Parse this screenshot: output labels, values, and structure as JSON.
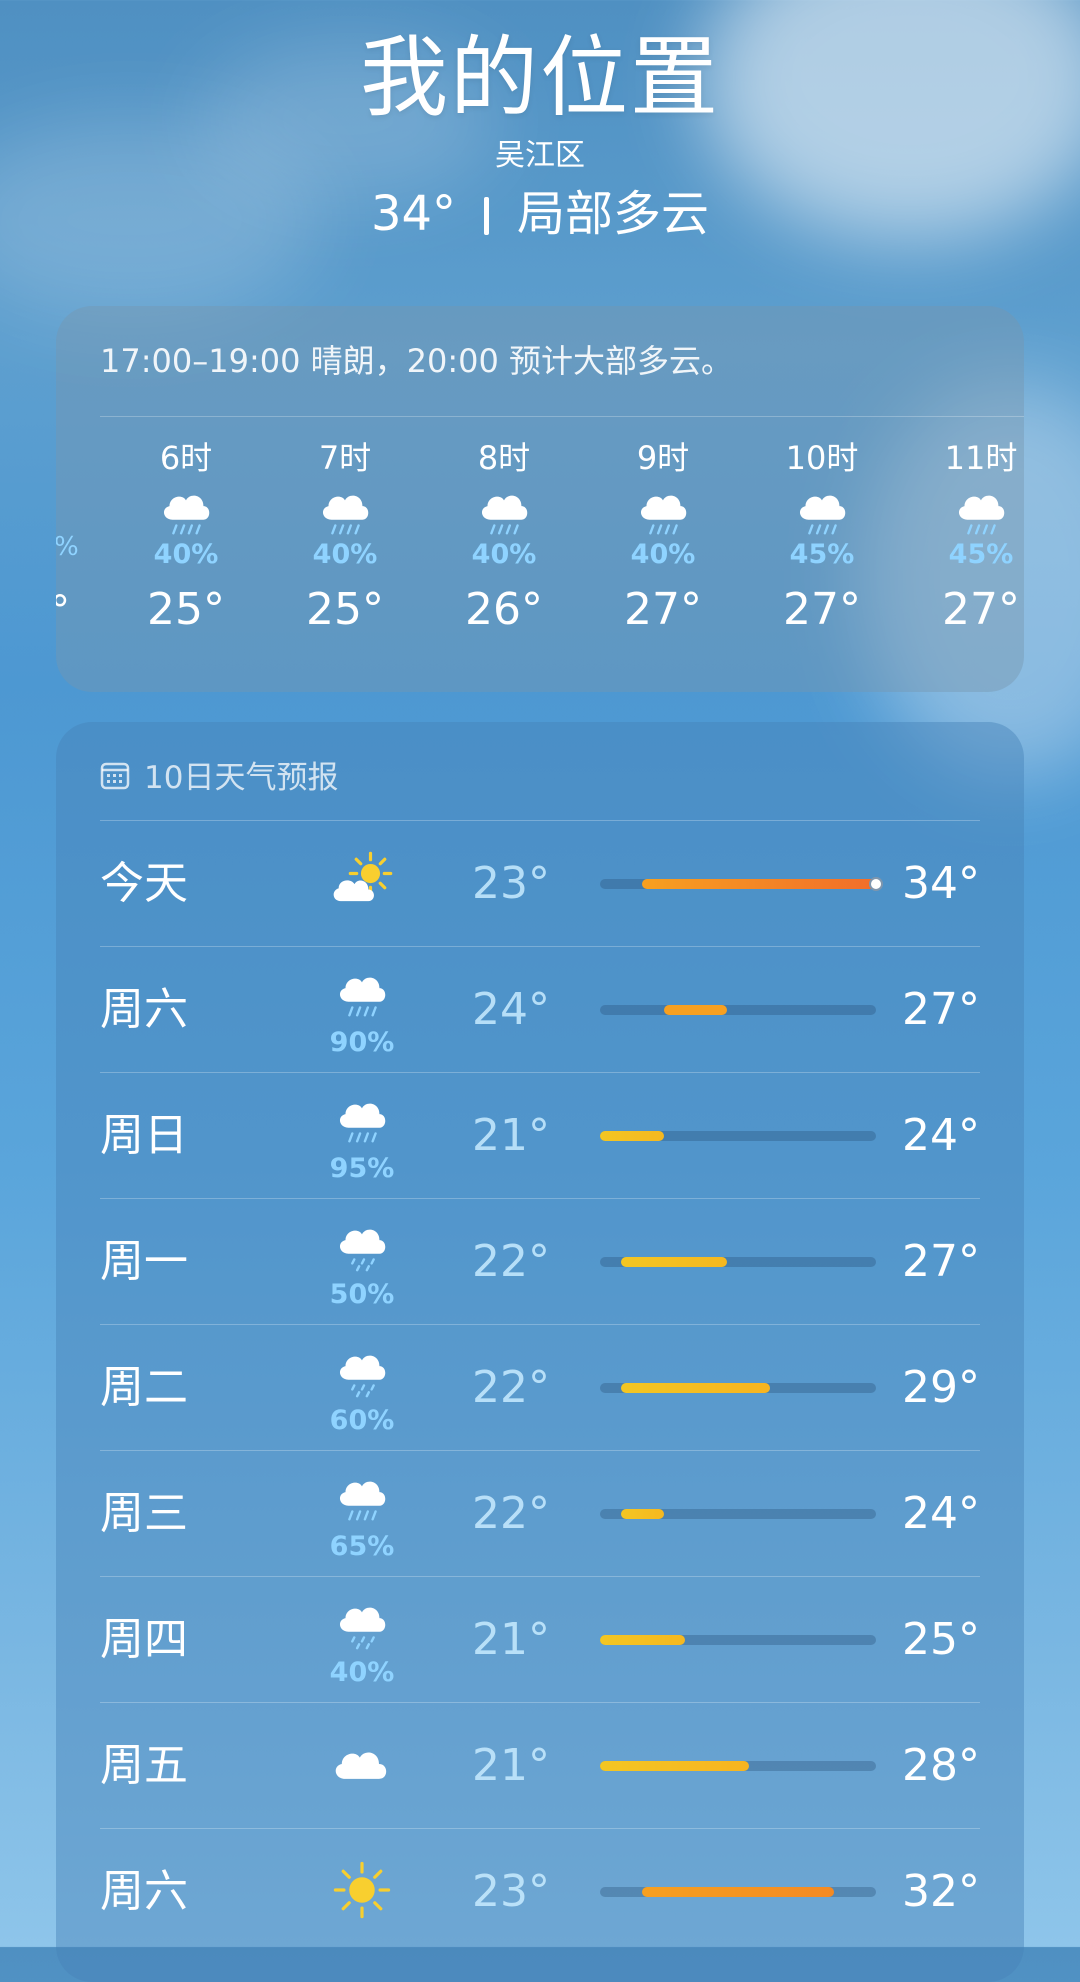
{
  "header": {
    "title": "我的位置",
    "district": "吴江区",
    "temp": "34°",
    "condition": "局部多云"
  },
  "hourly": {
    "summary": "17:00–19:00 晴朗，20:00 预计大部多云。",
    "edge_fragment_pct": "%",
    "edge_fragment_temp": "°",
    "hours": [
      {
        "label": "6时",
        "icon": "rain-cloud-icon",
        "pct": "40%",
        "temp": "25°"
      },
      {
        "label": "7时",
        "icon": "rain-cloud-icon",
        "pct": "40%",
        "temp": "25°"
      },
      {
        "label": "8时",
        "icon": "rain-cloud-icon",
        "pct": "40%",
        "temp": "26°"
      },
      {
        "label": "9时",
        "icon": "rain-cloud-icon",
        "pct": "40%",
        "temp": "27°"
      },
      {
        "label": "10时",
        "icon": "rain-cloud-icon",
        "pct": "45%",
        "temp": "27°"
      },
      {
        "label": "11时",
        "icon": "rain-cloud-icon",
        "pct": "45%",
        "temp": "27°"
      }
    ]
  },
  "daily": {
    "header": "10日天气预报",
    "range_min": 21,
    "range_max": 34,
    "current_temp": 34,
    "days": [
      {
        "day": "今天",
        "icon": "partly-sunny-icon",
        "pct": "",
        "low": "23°",
        "high": "34°",
        "low_v": 23,
        "high_v": 34
      },
      {
        "day": "周六",
        "icon": "rain-cloud-icon",
        "pct": "90%",
        "low": "24°",
        "high": "27°",
        "low_v": 24,
        "high_v": 27
      },
      {
        "day": "周日",
        "icon": "rain-cloud-icon",
        "pct": "95%",
        "low": "21°",
        "high": "24°",
        "low_v": 21,
        "high_v": 24
      },
      {
        "day": "周一",
        "icon": "drizzle-cloud-icon",
        "pct": "50%",
        "low": "22°",
        "high": "27°",
        "low_v": 22,
        "high_v": 27
      },
      {
        "day": "周二",
        "icon": "drizzle-cloud-icon",
        "pct": "60%",
        "low": "22°",
        "high": "29°",
        "low_v": 22,
        "high_v": 29
      },
      {
        "day": "周三",
        "icon": "rain-cloud-icon",
        "pct": "65%",
        "low": "22°",
        "high": "24°",
        "low_v": 22,
        "high_v": 24
      },
      {
        "day": "周四",
        "icon": "drizzle-cloud-icon",
        "pct": "40%",
        "low": "21°",
        "high": "25°",
        "low_v": 21,
        "high_v": 25
      },
      {
        "day": "周五",
        "icon": "cloud-icon",
        "pct": "",
        "low": "21°",
        "high": "28°",
        "low_v": 21,
        "high_v": 28
      },
      {
        "day": "周六",
        "icon": "sun-icon",
        "pct": "",
        "low": "23°",
        "high": "32°",
        "low_v": 23,
        "high_v": 32
      }
    ]
  },
  "colors": {
    "precip": "#8fd3ff",
    "bar_cool": "#f3c623",
    "bar_warm": "#f7a020",
    "bar_hot": "#f26d2a"
  }
}
